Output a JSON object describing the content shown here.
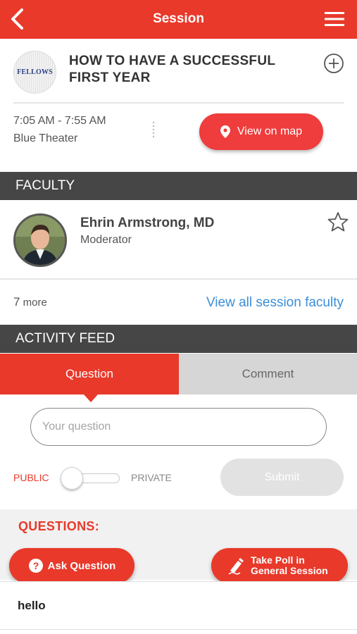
{
  "header": {
    "title": "Session",
    "back_icon": "chevron-left-icon",
    "menu_icon": "hamburger-menu-icon"
  },
  "session": {
    "logo_text": "FELLOWS",
    "title_line1": "HOW TO HAVE A SUCCESSFUL",
    "title_line2": "FIRST YEAR",
    "time": "7:05 AM - 7:55 AM",
    "location": "Blue Theater",
    "map_button": "View on map"
  },
  "faculty": {
    "section_title": "FACULTY",
    "name": "Ehrin Armstrong, MD",
    "role": "Moderator",
    "more_count": "7",
    "more_label": "more",
    "view_all": "View all session faculty"
  },
  "activity": {
    "section_title": "ACTIVITY FEED",
    "tabs": [
      "Question",
      "Comment"
    ],
    "active_tab": "Question",
    "input_placeholder": "Your question",
    "public_label": "PUBLIC",
    "private_label": "PRIVATE",
    "submit_label": "Submit"
  },
  "questions": {
    "heading": "QUESTIONS:",
    "ask_button": "Ask Question",
    "poll_line1": "Take Poll in",
    "poll_line2": "General Session",
    "items": [
      "hello"
    ]
  },
  "colors": {
    "accent": "#e8392a",
    "dark_band": "#464646",
    "link": "#3a8ed8"
  }
}
